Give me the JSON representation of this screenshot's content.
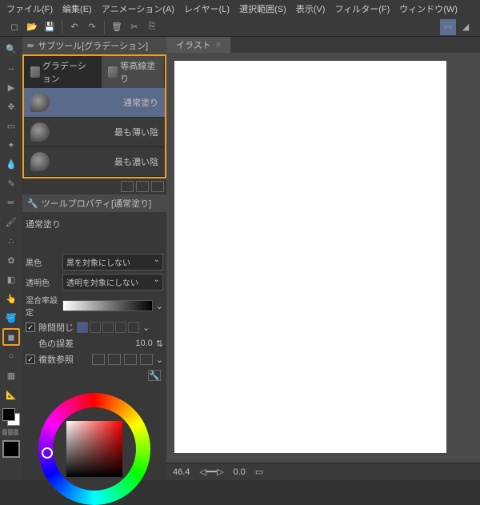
{
  "menu": {
    "file": "ファイル(F)",
    "edit": "編集(E)",
    "anim": "アニメーション(A)",
    "layer": "レイヤー(L)",
    "select": "選択範囲(S)",
    "view": "表示(V)",
    "filter": "フィルター(F)",
    "window": "ウィンドウ(W)"
  },
  "panels": {
    "subtool_title": "サブツール[グラデーション]",
    "tabs": {
      "gradation": "グラデーション",
      "contour": "等高線塗り"
    },
    "items": [
      "通常塗り",
      "最も薄い陰",
      "最も濃い陰"
    ],
    "toolprop_title": "ツールプロパティ[通常塗り]",
    "toolname": "通常塗り"
  },
  "props": {
    "black": "黒色",
    "black_opt": "黒を対象にしない",
    "trans": "透明色",
    "trans_opt": "透明を対象にしない",
    "blend": "混合率設定",
    "gap": "隙間閉じ",
    "tol": "色の誤差",
    "tol_val": "10.0",
    "multi": "複数参照"
  },
  "canvas": {
    "tab": "イラスト"
  },
  "status": {
    "zoom": "46.4",
    "angle": "0.0"
  }
}
